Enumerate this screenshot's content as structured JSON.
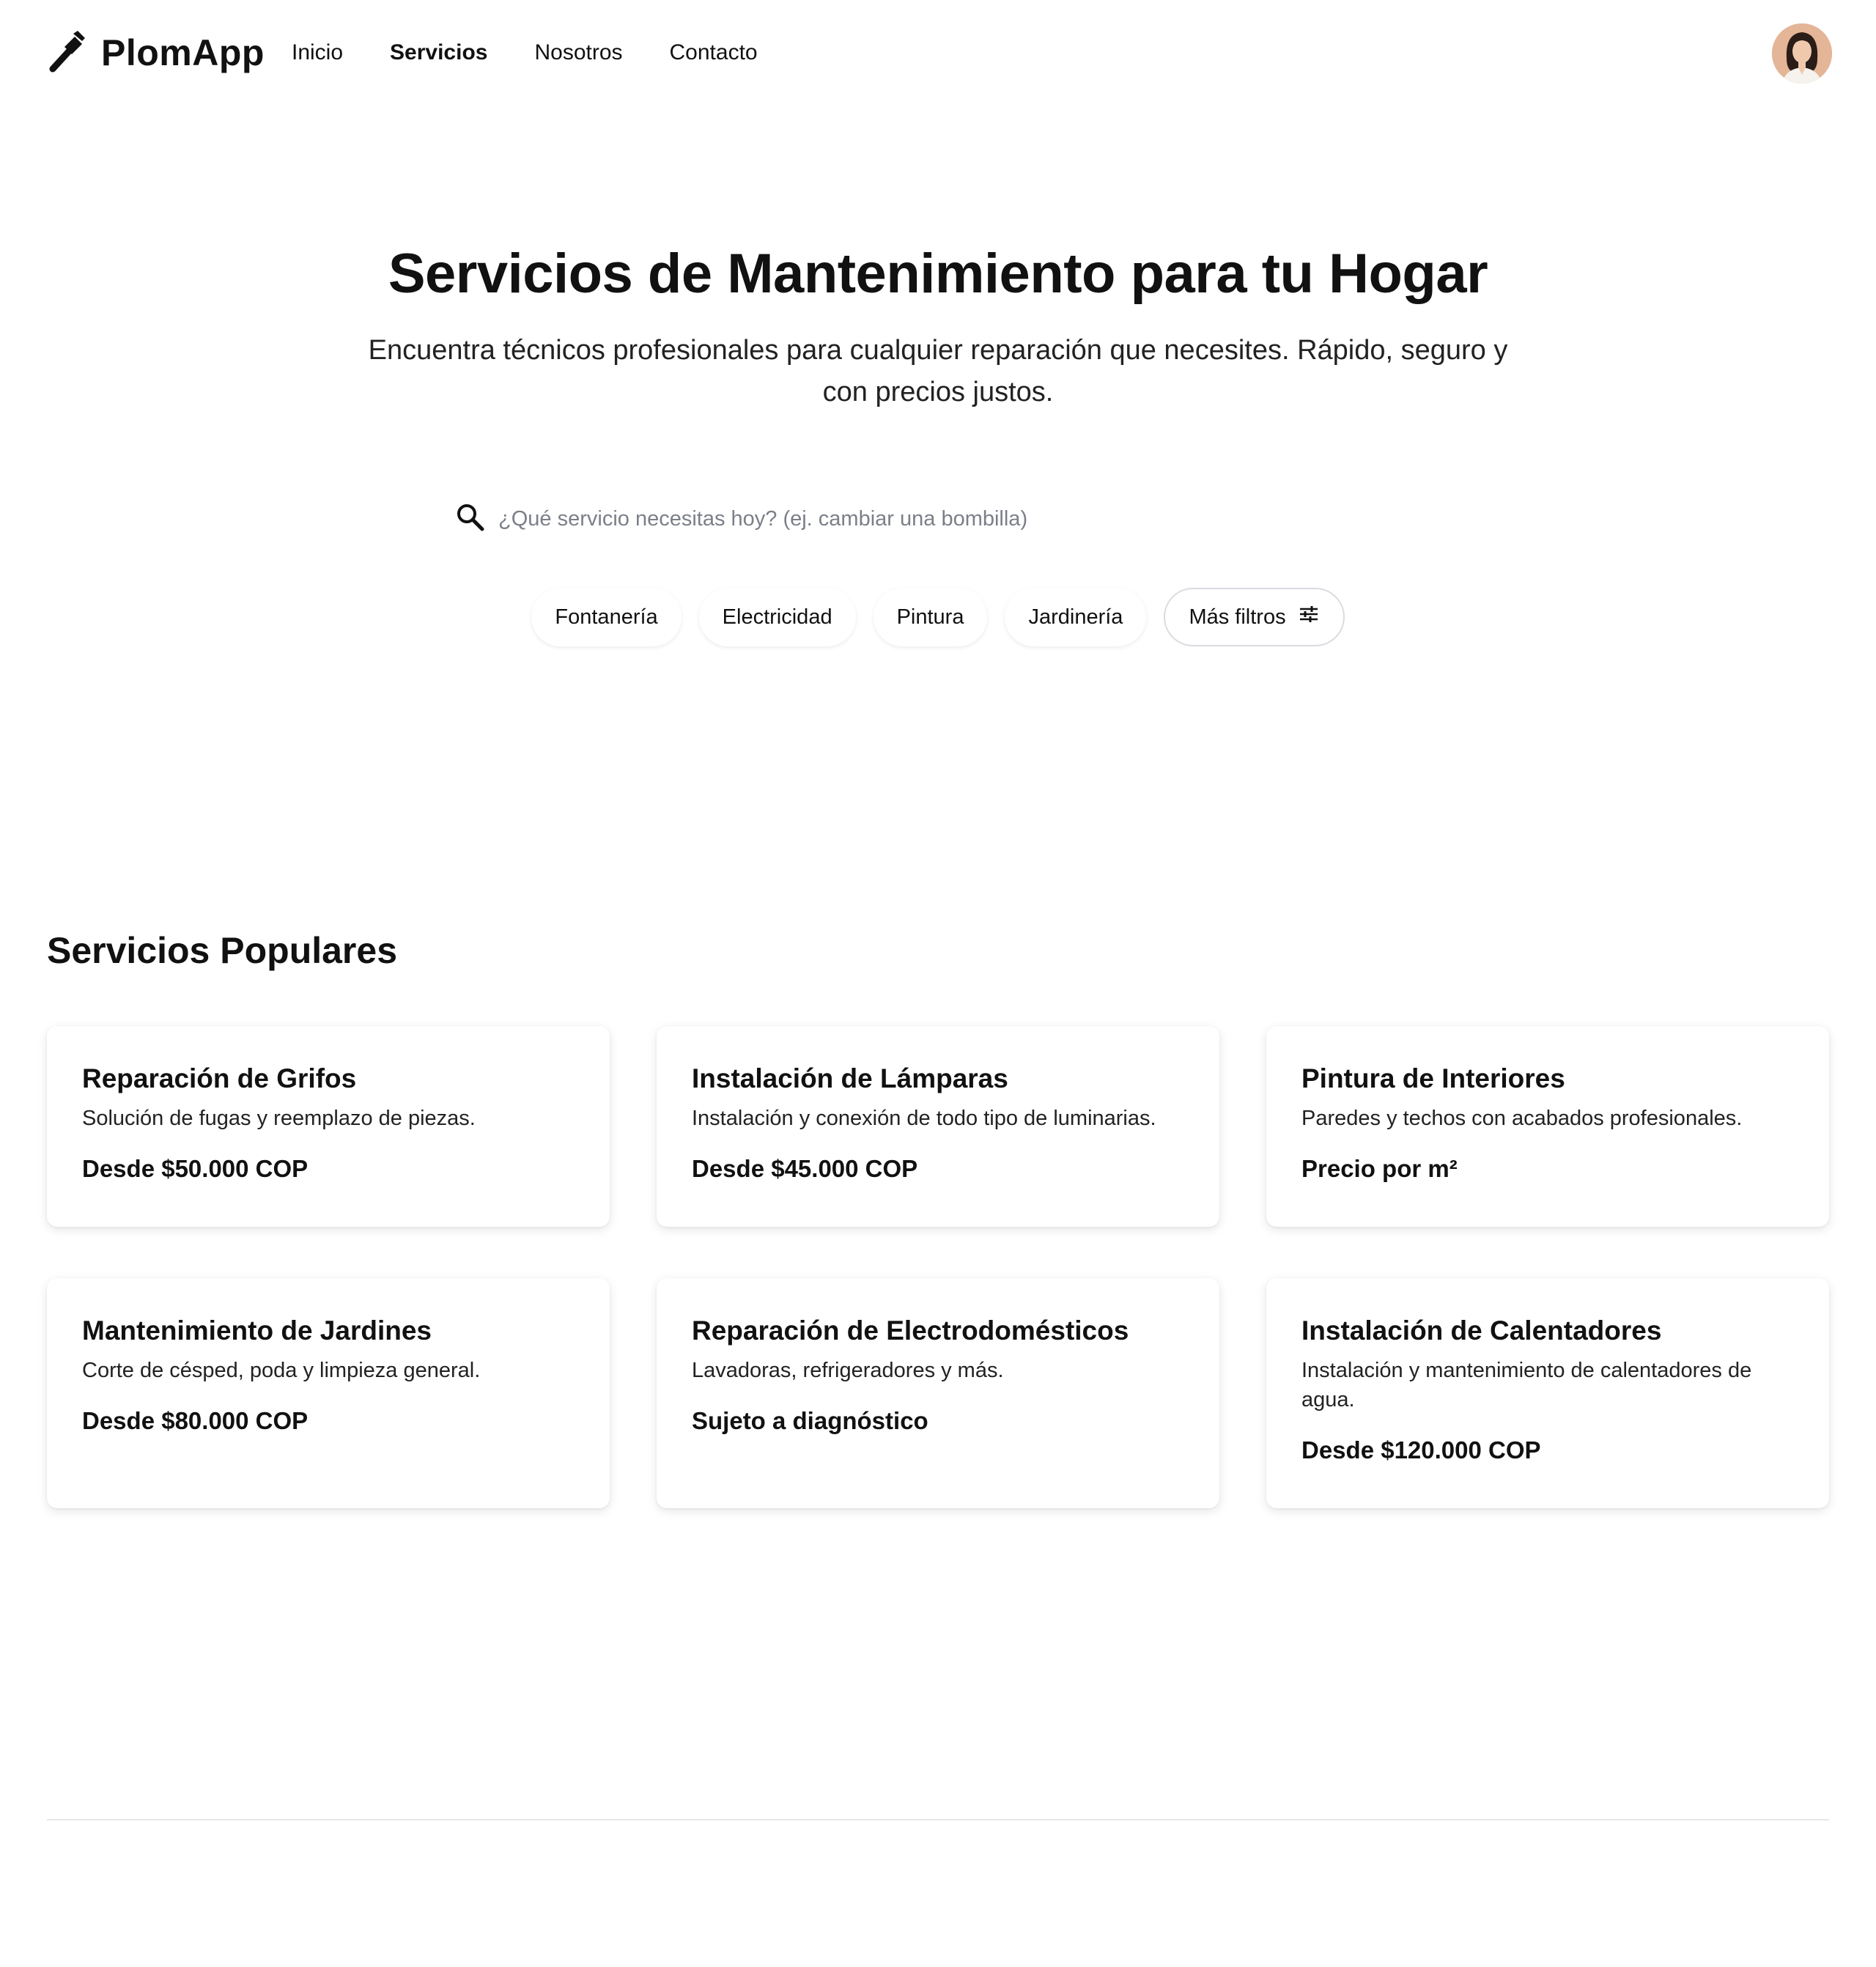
{
  "brand": {
    "name": "PlomApp",
    "icon": "wrench-icon"
  },
  "nav": {
    "items": [
      {
        "label": "Inicio",
        "active": false
      },
      {
        "label": "Servicios",
        "active": true
      },
      {
        "label": "Nosotros",
        "active": false
      },
      {
        "label": "Contacto",
        "active": false
      }
    ]
  },
  "user": {
    "avatar": "user-avatar"
  },
  "hero": {
    "title": "Servicios de Mantenimiento para tu Hogar",
    "subtitle": "Encuentra técnicos profesionales para cualquier reparación que necesites. Rápido, seguro y con precios justos."
  },
  "search": {
    "placeholder": "¿Qué servicio necesitas hoy? (ej. cambiar una bombilla)",
    "value": "",
    "icon": "search-icon"
  },
  "filters": {
    "chips": [
      "Fontanería",
      "Electricidad",
      "Pintura",
      "Jardinería"
    ],
    "more_label": "Más filtros",
    "more_icon": "sliders-icon"
  },
  "popular": {
    "title": "Servicios Populares",
    "cards": [
      {
        "title": "Reparación de Grifos",
        "description": "Solución de fugas y reemplazo de piezas.",
        "price": "Desde $50.000 COP"
      },
      {
        "title": "Instalación de Lámparas",
        "description": "Instalación y conexión de todo tipo de luminarias.",
        "price": "Desde $45.000 COP"
      },
      {
        "title": "Pintura de Interiores",
        "description": "Paredes y techos con acabados profesionales.",
        "price": "Precio por m²"
      },
      {
        "title": "Mantenimiento de Jardines",
        "description": "Corte de césped, poda y limpieza general.",
        "price": "Desde $80.000 COP"
      },
      {
        "title": "Reparación de Electrodomésticos",
        "description": "Lavadoras, refrigeradores y más.",
        "price": "Sujeto a diagnóstico"
      },
      {
        "title": "Instalación de Calentadores",
        "description": "Instalación y mantenimiento de calentadores de agua.",
        "price": "Desde $120.000 COP"
      }
    ]
  },
  "colors": {
    "text": "#111111",
    "muted": "#7b7f88",
    "border": "#d9dbe0",
    "avatar_bg": "#e4b597"
  }
}
